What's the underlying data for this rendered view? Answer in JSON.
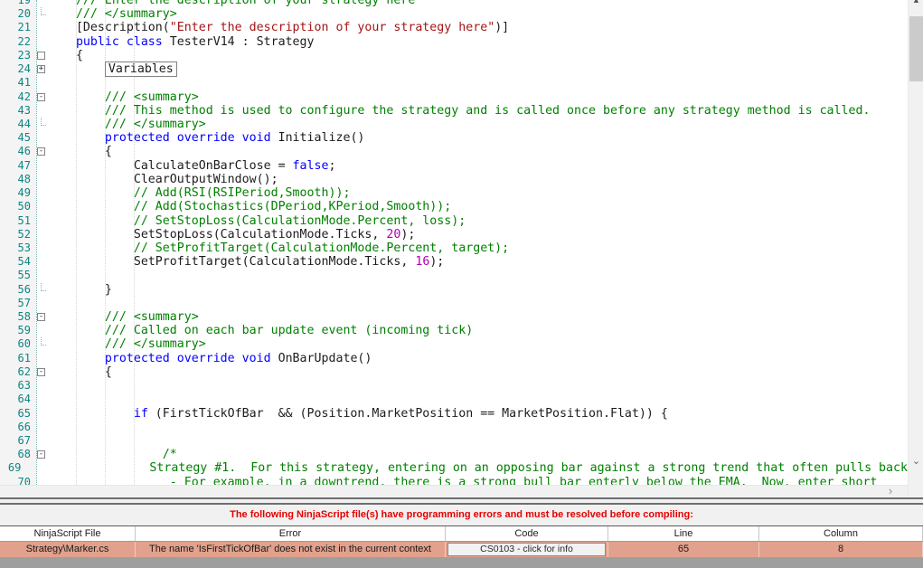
{
  "editor": {
    "syntax_colors": {
      "comment": "#008000",
      "keyword": "#0000ff",
      "string": "#a31515",
      "number": "#b000b0",
      "plain": "#1c1c1c",
      "line_number": "#0d8585"
    },
    "lines": [
      {
        "n": "19",
        "fold": "",
        "segs": [
          [
            "com",
            "    /// Enter the description of your strategy here"
          ]
        ]
      },
      {
        "n": "20",
        "fold": "end",
        "segs": [
          [
            "com",
            "    /// </summary>"
          ]
        ]
      },
      {
        "n": "21",
        "fold": "",
        "segs": [
          [
            "pln",
            "    [Description("
          ],
          [
            "str",
            "\"Enter the description of your strategy here\""
          ],
          [
            "pln",
            ")]"
          ]
        ]
      },
      {
        "n": "22",
        "fold": "",
        "segs": [
          [
            "kw",
            "    public class"
          ],
          [
            "pln",
            " TesterV14 : Strategy"
          ]
        ]
      },
      {
        "n": "23",
        "fold": "box0",
        "segs": [
          [
            "pln",
            "    {"
          ]
        ]
      },
      {
        "n": "24",
        "fold": "plus",
        "segs": [
          [
            "pln",
            "        "
          ],
          [
            "box",
            "Variables"
          ]
        ]
      },
      {
        "n": "41",
        "fold": "",
        "segs": []
      },
      {
        "n": "42",
        "fold": "minus",
        "segs": [
          [
            "com",
            "        /// <summary>"
          ]
        ]
      },
      {
        "n": "43",
        "fold": "",
        "segs": [
          [
            "com",
            "        /// This method is used to configure the strategy and is called once before any strategy method is called."
          ]
        ]
      },
      {
        "n": "44",
        "fold": "end",
        "segs": [
          [
            "com",
            "        /// </summary>"
          ]
        ]
      },
      {
        "n": "45",
        "fold": "",
        "segs": [
          [
            "kw",
            "        protected override void"
          ],
          [
            "pln",
            " Initialize()"
          ]
        ]
      },
      {
        "n": "46",
        "fold": "minus",
        "segs": [
          [
            "pln",
            "        {"
          ]
        ]
      },
      {
        "n": "47",
        "fold": "",
        "segs": [
          [
            "pln",
            "            CalculateOnBarClose = "
          ],
          [
            "kw",
            "false"
          ],
          [
            "pln",
            ";"
          ]
        ]
      },
      {
        "n": "48",
        "fold": "",
        "segs": [
          [
            "pln",
            "            ClearOutputWindow();"
          ]
        ]
      },
      {
        "n": "49",
        "fold": "",
        "segs": [
          [
            "com",
            "            // Add(RSI(RSIPeriod,Smooth));"
          ]
        ]
      },
      {
        "n": "50",
        "fold": "",
        "segs": [
          [
            "com",
            "            // Add(Stochastics(DPeriod,KPeriod,Smooth));"
          ]
        ]
      },
      {
        "n": "51",
        "fold": "",
        "segs": [
          [
            "com",
            "            // SetStopLoss(CalculationMode.Percent, loss);"
          ]
        ]
      },
      {
        "n": "52",
        "fold": "",
        "segs": [
          [
            "pln",
            "            SetStopLoss(CalculationMode.Ticks, "
          ],
          [
            "num",
            "20"
          ],
          [
            "pln",
            ");"
          ]
        ]
      },
      {
        "n": "53",
        "fold": "",
        "segs": [
          [
            "com",
            "            // SetProfitTarget(CalculationMode.Percent, target);"
          ]
        ]
      },
      {
        "n": "54",
        "fold": "",
        "segs": [
          [
            "pln",
            "            SetProfitTarget(CalculationMode.Ticks, "
          ],
          [
            "num",
            "16"
          ],
          [
            "pln",
            ");"
          ]
        ]
      },
      {
        "n": "55",
        "fold": "",
        "segs": []
      },
      {
        "n": "56",
        "fold": "end",
        "segs": [
          [
            "pln",
            "        }"
          ]
        ]
      },
      {
        "n": "57",
        "fold": "",
        "segs": []
      },
      {
        "n": "58",
        "fold": "minus",
        "segs": [
          [
            "com",
            "        /// <summary>"
          ]
        ]
      },
      {
        "n": "59",
        "fold": "",
        "segs": [
          [
            "com",
            "        /// Called on each bar update event (incoming tick)"
          ]
        ]
      },
      {
        "n": "60",
        "fold": "end",
        "segs": [
          [
            "com",
            "        /// </summary>"
          ]
        ]
      },
      {
        "n": "61",
        "fold": "",
        "segs": [
          [
            "kw",
            "        protected override void"
          ],
          [
            "pln",
            " OnBarUpdate()"
          ]
        ]
      },
      {
        "n": "62",
        "fold": "minus",
        "segs": [
          [
            "pln",
            "        {"
          ]
        ]
      },
      {
        "n": "63",
        "fold": "",
        "segs": []
      },
      {
        "n": "64",
        "fold": "",
        "segs": []
      },
      {
        "n": "65",
        "fold": "",
        "segs": [
          [
            "kw",
            "            if"
          ],
          [
            "pln",
            " (FirstTickOfBar  && (Position.MarketPosition == MarketPosition.Flat)) {"
          ]
        ]
      },
      {
        "n": "66",
        "fold": "",
        "segs": []
      },
      {
        "n": "67",
        "fold": "",
        "segs": []
      },
      {
        "n": "68",
        "fold": "minus",
        "segs": [
          [
            "com",
            "                /*"
          ]
        ]
      },
      {
        "n": "69",
        "fold": "",
        "segs": [
          [
            "com",
            "                Strategy #1.  For this strategy, entering on an opposing bar against a strong trend that often pulls back"
          ]
        ]
      },
      {
        "n": "70",
        "fold": "",
        "segs": [
          [
            "com",
            "                 - For example, in a downtrend, there is a strong bull bar enterly below the EMA.  Now, enter short"
          ]
        ]
      }
    ],
    "scrollbar": {
      "up_arrow": "▲",
      "down_arrow": "⌄",
      "right_arrow": "›"
    }
  },
  "error_panel": {
    "message": "The following NinjaScript file(s) have programming errors and must be resolved before compiling:",
    "message_color": "#e60000",
    "row_highlight_color": "#e2a18c",
    "columns": [
      "NinjaScript File",
      "Error",
      "Code",
      "Line",
      "Column"
    ],
    "rows": [
      {
        "file": "Strategy\\Marker.cs",
        "error": "The name 'IsFirstTickOfBar' does not exist in the current context",
        "code": "CS0103 - click for info",
        "line": "65",
        "column": "8"
      }
    ]
  }
}
